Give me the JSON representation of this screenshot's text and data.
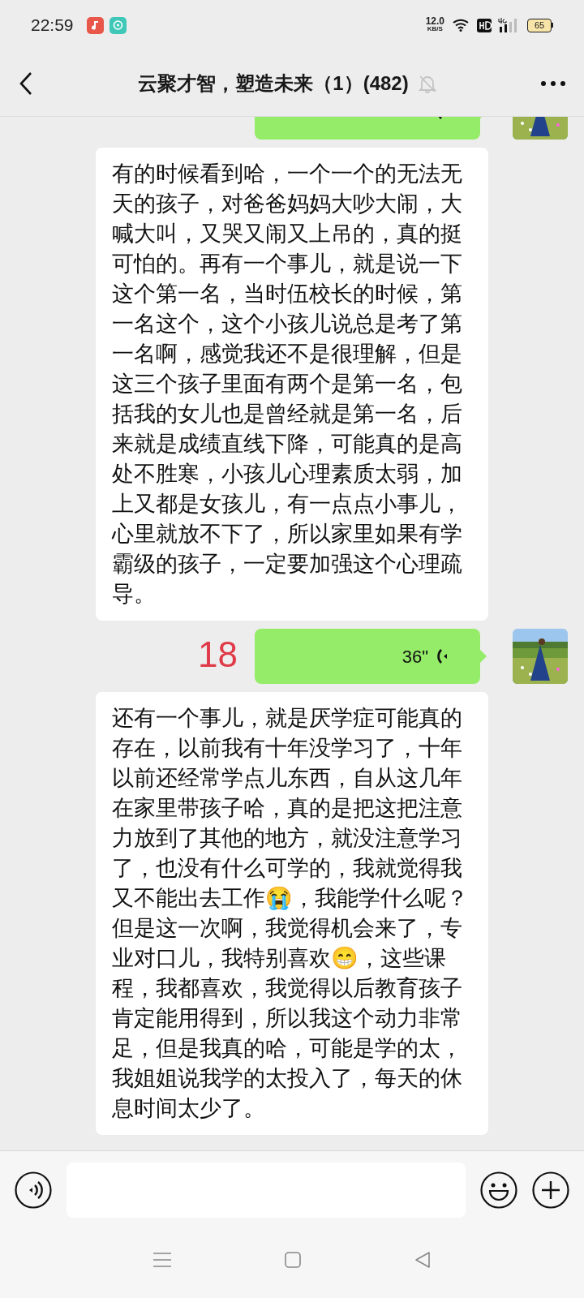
{
  "status_bar": {
    "time": "22:59",
    "net_speed": "12.0",
    "net_unit": "KB/S",
    "battery": "65"
  },
  "header": {
    "title": "云聚才智，塑造未来（1）(482)",
    "muted": true
  },
  "messages": [
    {
      "kind": "voice"
    },
    {
      "kind": "text",
      "text": "有的时候看到哈，一个一个的无法无天的孩子，对爸爸妈妈大吵大闹，大喊大叫，又哭又闹又上吊的，真的挺可怕的。再有一个事儿，就是说一下这个第一名，当时伍校长的时候，第一名这个，这个小孩儿说总是考了第一名啊，感觉我还不是很理解，但是这三个孩子里面有两个是第一名，包括我的女儿也是曾经就是第一名，后来就是成绩直线下降，可能真的是高处不胜寒，小孩儿心理素质太弱，加上又都是女孩儿，有一点点小事儿，心里就放不下了，所以家里如果有学霸级的孩子，一定要加强这个心理疏导。"
    },
    {
      "kind": "voice",
      "duration": "36\"",
      "note": "18"
    },
    {
      "kind": "text",
      "text": "还有一个事儿，就是厌学症可能真的存在，以前我有十年没学习了，十年以前还经常学点儿东西，自从这几年在家里带孩子哈，真的是把这把注意力放到了其他的地方，就没注意学习了，也没有什么可学的，我就觉得我又不能出去工作😭，我能学什么呢？但是这一次啊，我觉得机会来了，专业对口儿，我特别喜欢😁，这些课程，我都喜欢，我觉得以后教育孩子肯定能用得到，所以我这个动力非常足，但是我真的哈，可能是学的太，我姐姐说我学的太投入了，每天的休息时间太少了。"
    }
  ]
}
